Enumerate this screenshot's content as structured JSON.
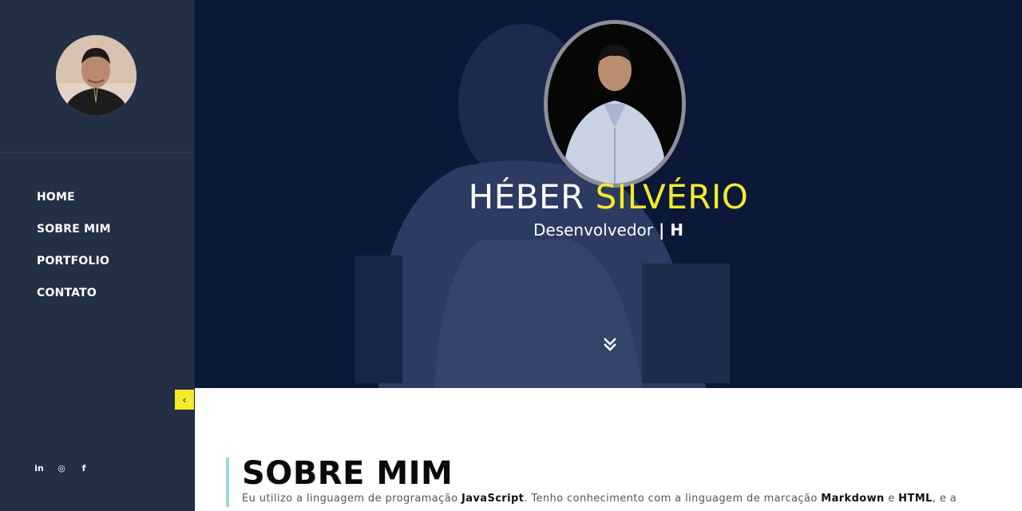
{
  "sidebar": {
    "nav": [
      {
        "label": "HOME"
      },
      {
        "label": "SOBRE MIM"
      },
      {
        "label": "PORTFOLIO"
      },
      {
        "label": "CONTATO"
      }
    ],
    "collapse_icon": "‹",
    "social": [
      {
        "icon": "linkedin-icon",
        "glyph": "in"
      },
      {
        "icon": "instagram-icon",
        "glyph": "◎"
      },
      {
        "icon": "facebook-icon",
        "glyph": "f"
      }
    ]
  },
  "hero": {
    "first_name": "HÉBER",
    "last_name": "SILVÉRIO",
    "role": "Desenvolvedor",
    "role_separator": " | ",
    "role_suffix": "H"
  },
  "about": {
    "title": "SOBRE MIM",
    "text_1": "Eu utilizo a linguagem de programação ",
    "text_b1": "JavaScript",
    "text_2": ". Tenho conhecimento com a linguagem de marcação ",
    "text_b2": "Markdown",
    "text_3": " e ",
    "text_b3": "HTML",
    "text_4": ", e a"
  },
  "colors": {
    "sidebar_bg": "#232f45",
    "hero_bg": "#0c1a3c",
    "accent_yellow": "#f5ea2a",
    "about_bar": "#9ed6d9"
  }
}
